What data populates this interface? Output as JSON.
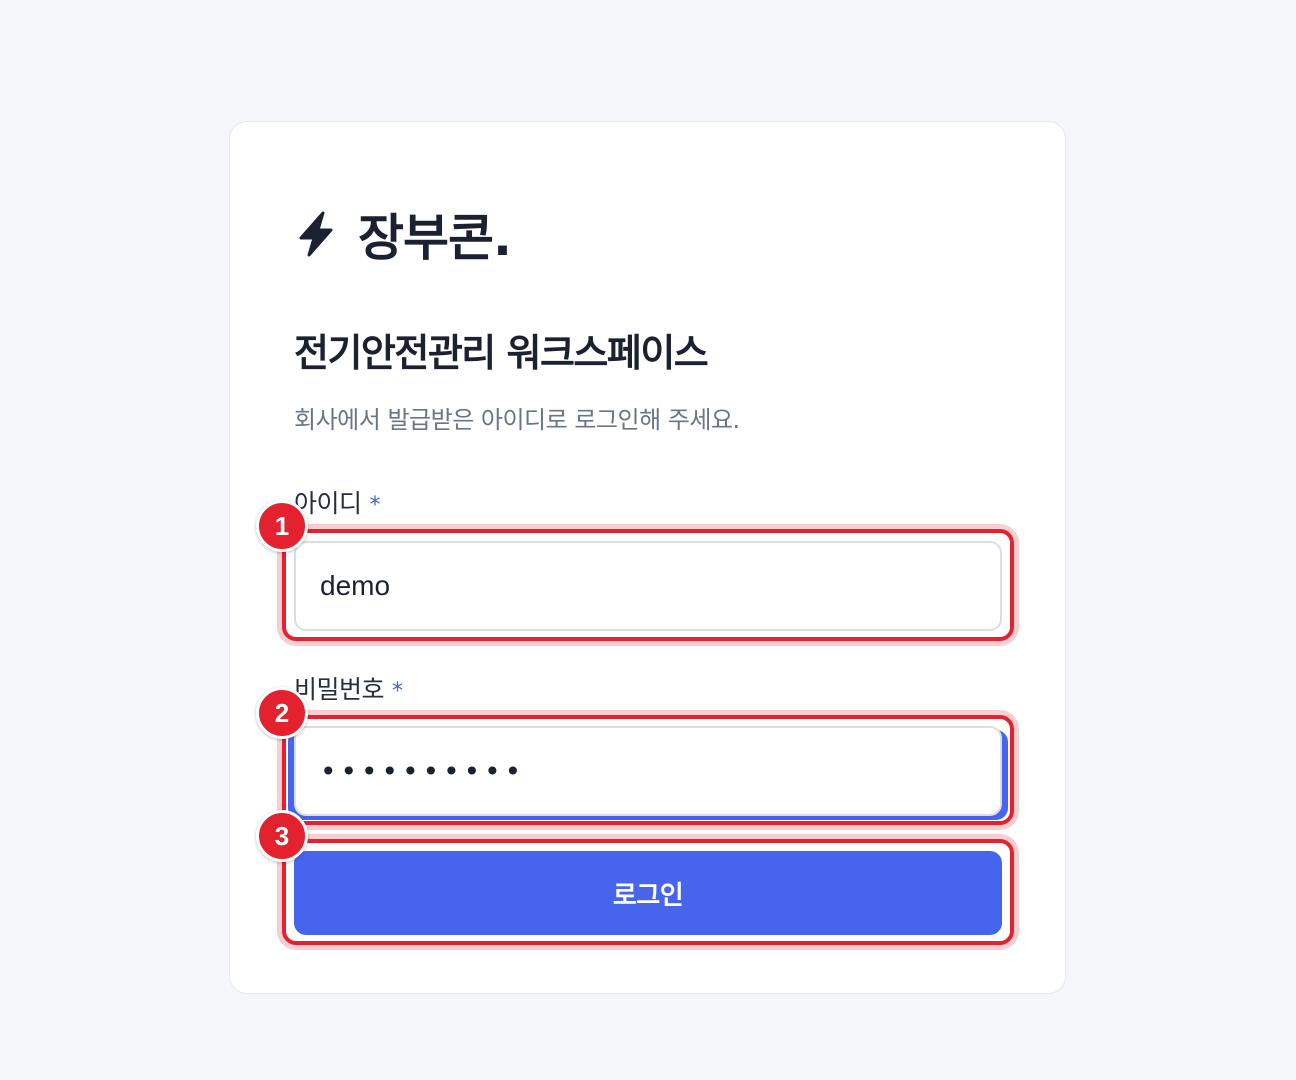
{
  "brand": {
    "icon": "lightning-bolt-icon",
    "name": "장부콘."
  },
  "title": "전기안전관리 워크스페이스",
  "subtitle": "회사에서 발급받은 아이디로 로그인해 주세요.",
  "form": {
    "id_label": "아이디",
    "id_required_mark": "*",
    "id_value": "demo",
    "pw_label": "비밀번호",
    "pw_required_mark": "*",
    "pw_value": "••••••••••",
    "login_label": "로그인"
  },
  "annotations": [
    "1",
    "2",
    "3"
  ],
  "colors": {
    "accent": "#4665ec",
    "annotation": "#e3212f",
    "text": "#1b2131",
    "muted": "#6b7587"
  }
}
